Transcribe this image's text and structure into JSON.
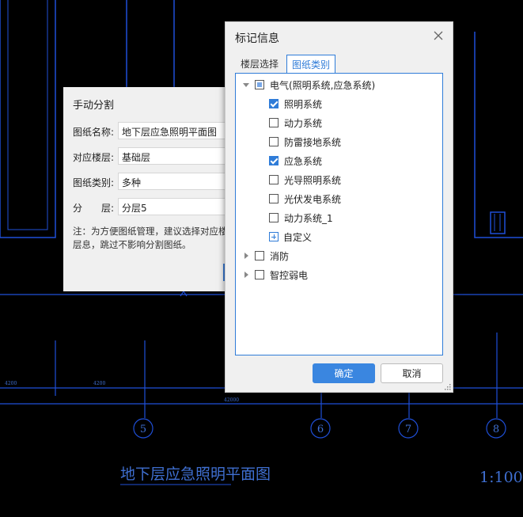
{
  "drawing": {
    "title_text": "地下层应急照明平面图",
    "scale_text": "1:100",
    "axis_labels": [
      "5",
      "6",
      "7",
      "8"
    ],
    "dim_labels": [
      "4200",
      "4200",
      "42000"
    ]
  },
  "split_dialog": {
    "title": "手动分割",
    "fields": [
      {
        "label": "图纸名称:",
        "value": "地下层应急照明平面图"
      },
      {
        "label": "对应楼层:",
        "value": "基础层"
      },
      {
        "label": "图纸类别:",
        "value": "多种"
      },
      {
        "label": "分　　层:",
        "value": "分层5"
      }
    ],
    "note": "注：为方便图纸管理，建议选择对应楼层息，跳过不影响分割图纸。"
  },
  "mark_dialog": {
    "title": "标记信息",
    "tabs": [
      {
        "label": "楼层选择",
        "active": false
      },
      {
        "label": "图纸类别",
        "active": true
      }
    ],
    "tree": {
      "electric": {
        "label": "电气(照明系统,应急系统)",
        "expanded": true,
        "state": "partial",
        "children": [
          {
            "label": "照明系统",
            "checked": true
          },
          {
            "label": "动力系统",
            "checked": false
          },
          {
            "label": "防雷接地系统",
            "checked": false
          },
          {
            "label": "应急系统",
            "checked": true
          },
          {
            "label": "光导照明系统",
            "checked": false
          },
          {
            "label": "光伏发电系统",
            "checked": false
          },
          {
            "label": "动力系统_1",
            "checked": false
          }
        ],
        "custom_label": "自定义"
      },
      "fire": {
        "label": "消防",
        "expanded": false,
        "checked": false
      },
      "weak": {
        "label": "智控弱电",
        "expanded": false,
        "checked": false
      }
    },
    "ok_label": "确定",
    "cancel_label": "取消"
  },
  "colors": {
    "accent": "#2f7cd8",
    "cad_line": "#1f4fd8",
    "cad_text": "#3f6fd1"
  }
}
